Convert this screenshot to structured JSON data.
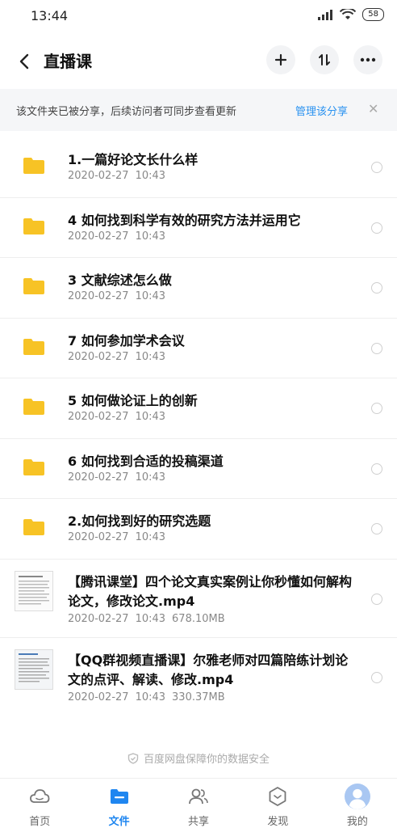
{
  "status": {
    "time": "13:44",
    "battery": "58"
  },
  "header": {
    "title": "直播课"
  },
  "notice": {
    "text": "该文件夹已被分享，后续访问者可同步查看更新",
    "link": "管理该分享"
  },
  "files": [
    {
      "type": "folder",
      "name": "1.一篇好论文长什么样",
      "date": "2020-02-27",
      "time": "10:43",
      "size": ""
    },
    {
      "type": "folder",
      "name": "4 如何找到科学有效的研究方法并运用它",
      "date": "2020-02-27",
      "time": "10:43",
      "size": ""
    },
    {
      "type": "folder",
      "name": "3 文献综述怎么做",
      "date": "2020-02-27",
      "time": "10:43",
      "size": ""
    },
    {
      "type": "folder",
      "name": "7 如何参加学术会议",
      "date": "2020-02-27",
      "time": "10:43",
      "size": ""
    },
    {
      "type": "folder",
      "name": "5 如何做论证上的创新",
      "date": "2020-02-27",
      "time": "10:43",
      "size": ""
    },
    {
      "type": "folder",
      "name": "6 如何找到合适的投稿渠道",
      "date": "2020-02-27",
      "time": "10:43",
      "size": ""
    },
    {
      "type": "folder",
      "name": "2.如何找到好的研究选题",
      "date": "2020-02-27",
      "time": "10:43",
      "size": ""
    },
    {
      "type": "video",
      "name": "【腾讯课堂】四个论文真实案例让你秒懂如何解构论文，修改论文.mp4",
      "date": "2020-02-27",
      "time": "10:43",
      "size": "678.10MB"
    },
    {
      "type": "video",
      "name": "【QQ群视频直播课】尔雅老师对四篇陪练计划论文的点评、解读、修改.mp4",
      "date": "2020-02-27",
      "time": "10:43",
      "size": "330.37MB"
    }
  ],
  "safety_text": "百度网盘保障你的数据安全",
  "tabs": [
    {
      "label": "首页",
      "icon": "cloud-icon"
    },
    {
      "label": "文件",
      "icon": "folder-icon"
    },
    {
      "label": "共享",
      "icon": "people-icon"
    },
    {
      "label": "发现",
      "icon": "hexagon-icon"
    },
    {
      "label": "我的",
      "icon": "avatar-icon"
    }
  ],
  "colors": {
    "accent": "#1f86f0",
    "folder": "#f7c325",
    "link": "#2a92f0"
  }
}
